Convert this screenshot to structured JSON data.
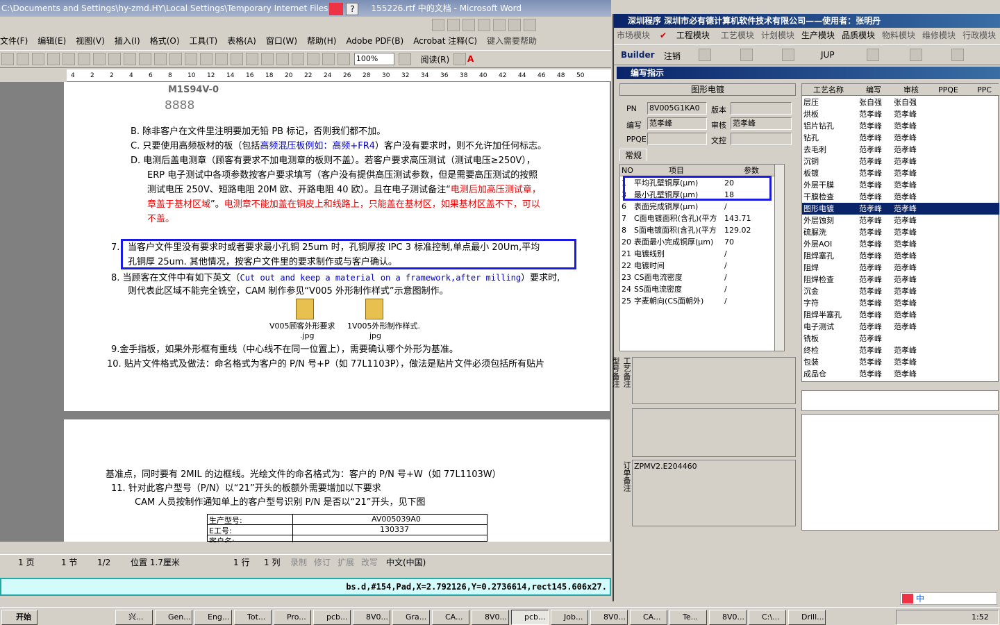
{
  "word": {
    "title": "C:\\Documents and Settings\\hy-zmd.HY\\Local Settings\\Temporary Internet Files",
    "title_suffix": "155226.rtf 中的文档 - Microsoft Word",
    "menu": [
      "文件(F)",
      "编辑(E)",
      "视图(V)",
      "插入(I)",
      "格式(O)",
      "工具(T)",
      "表格(A)",
      "窗口(W)",
      "帮助(H)",
      "Adobe PDF(B)",
      "Acrobat 注释(C)"
    ],
    "help_hint": "键入需要帮助",
    "zoom": "100%",
    "read_label": "阅读(R)",
    "ruler": [
      "4",
      "2",
      "2",
      "4",
      "6",
      "8",
      "10",
      "12",
      "14",
      "16",
      "18",
      "20",
      "22",
      "24",
      "26",
      "28",
      "30",
      "32",
      "34",
      "36",
      "38",
      "40",
      "42",
      "44",
      "46",
      "48",
      "50"
    ],
    "logo_text": "M1S94V-0",
    "logo_digits": "8888",
    "para_b": "B.  除非客户在文件里注明要加无铅 PB 标记，否则我们都不加。",
    "para_c_prefix": "C.  只要使用高频板材的板（包括",
    "para_c_blue": "高频混压板例如：高频+FR4",
    "para_c_suffix": "）客户没有要求时，则不允许加任何标志。",
    "para_d1": "D.  电测后盖电测章（顾客有要求不加电测章的板则不盖）。若客户要求高压测试（测试电压≥250V），",
    "para_d2": "ERP 电子测试中各项参数按客户要求填写（客户没有提供高压测试参数，但是需要高压测试的按照",
    "para_d3_a": "测试电压 250V、短路电阻 20M 欧、开路电阻 40 欧）。且在电子测试备注“",
    "para_d3_red": "电测后加高压测试章，",
    "para_d4_red1": "章盖于基材区域",
    "para_d4_mid": "”。",
    "para_d4_red2": "电测章不能加盖在铜皮上和线路上，只能盖在基材区，如果基材区盖不下，可以",
    "para_d5_red": "不盖。",
    "para_7_num": "7.",
    "para_7a": "当客户文件里没有要求时或者要求最小孔铜 25um 时，孔铜厚按 IPC 3 标准控制,单点最小 20Um,平均",
    "para_7b": "孔铜厚 25um. 其他情况，按客户文件里的要求制作或与客户确认。",
    "para_8a_pre": "8.  当顾客在文件中有如下英文（",
    "para_8a_blue": "Cut out and keep a material on a framework,after milling",
    "para_8a_post": "）要求时,",
    "para_8b": "则代表此区域不能完全铣空，CAM 制作参见“V005 外形制作样式”示意图制作。",
    "attach1": "V005顾客外形要求",
    "attach1b": ".jpg",
    "attach2": "1V005外形制作样式.",
    "attach2b": "jpg",
    "para_9": "9.金手指板，如果外形框有重线（中心线不在同一位置上），需要确认哪个外形为基准。",
    "para_10": "10. 贴片文件格式及做法：命名格式为客户的 P/N 号+P（如 77L1103P），做法是贴片文件必须包括所有贴片",
    "p2_line1": "基准点，同时要有 2MIL 的边框线。光绘文件的命名格式为：客户的  P/N 号+W（如 77L1103W）",
    "p2_line2": "11.  针对此客户型号（P/N）以“21”开头的板额外需要增加以下要求",
    "p2_line3": "CAM 人员按制作通知单上的客户型号识别 P/N 是否以“21”开头，见下图",
    "p2_table": [
      [
        "生产型号:",
        "AV005039A0"
      ],
      [
        "E工号:",
        "130337"
      ],
      [
        "客户名:",
        ""
      ]
    ],
    "status": {
      "page": "1 页",
      "section": "1 节",
      "pages": "1/2",
      "pos": "位置 1.7厘米",
      "line": "1 行",
      "col": "1 列",
      "rec": "录制",
      "rev": "修订",
      "ext": "扩展",
      "ovr": "改写",
      "lang": "中文(中国)"
    },
    "cmdline": "bs.d,#154,Pad,X=2.792126,Y=0.2736614,rect145.606x27."
  },
  "app": {
    "title": "深圳程序   深圳市必有德计算机软件技术有限公司——使用者：张明丹",
    "modules": [
      "市场模块",
      "工程模块",
      "工艺模块",
      "计划模块",
      "生产模块",
      "品质模块",
      "物料模块",
      "维修模块",
      "行政模块"
    ],
    "builder": "Builder",
    "logout": "注销",
    "jup": "JUP",
    "dialog_title": "编写指示",
    "process_name": "图形电镀",
    "fields": {
      "pn_label": "PN",
      "pn_value": "8V005G1KA0",
      "version_label": "版本",
      "version_value": "",
      "author_label": "编写",
      "author_value": "范孝峰",
      "audit_label": "审核",
      "audit_value": "范孝峰",
      "ppqe_label": "PPQE",
      "ppqe_value": "",
      "doc_label": "文控",
      "doc_value": ""
    },
    "tab": "常规",
    "param_headers": [
      "NO",
      "项目",
      "参数"
    ],
    "params": [
      [
        "1",
        "平均孔壁铜厚(μm)",
        "20"
      ],
      [
        "3",
        "最小孔壁铜厚(μm)",
        "18"
      ],
      [
        "6",
        "表面完成铜厚(μm)",
        "/"
      ],
      [
        "7",
        "C面电镀面积(含孔)(平方",
        "143.71"
      ],
      [
        "8",
        "S面电镀面积(含孔)(平方",
        "129.02"
      ],
      [
        "20",
        "表面最小完成铜厚(μm)",
        "70"
      ],
      [
        "21",
        "电镀线别",
        "/"
      ],
      [
        "22",
        "电镀时间",
        "/"
      ],
      [
        "23",
        "CS面电流密度",
        "/"
      ],
      [
        "24",
        "SS面电流密度",
        "/"
      ],
      [
        "25",
        "字麦朝向(CS面朝外)",
        "/"
      ]
    ],
    "remark_labels": [
      "工艺备注",
      "型号备注",
      "订单备注"
    ],
    "order_remark": "ZPMV2.E204460",
    "proc_headers": [
      "工艺名称",
      "编写",
      "审核",
      "PPQE",
      "PPC"
    ],
    "procs": [
      [
        "层压",
        "张自强",
        "张自强"
      ],
      [
        "烘板",
        "范孝峰",
        "范孝峰"
      ],
      [
        "铝片钻孔",
        "范孝峰",
        "范孝峰"
      ],
      [
        "钻孔",
        "范孝峰",
        "范孝峰"
      ],
      [
        "去毛刺",
        "范孝峰",
        "范孝峰"
      ],
      [
        "沉铜",
        "范孝峰",
        "范孝峰"
      ],
      [
        "板镀",
        "范孝峰",
        "范孝峰"
      ],
      [
        "外层干膜",
        "范孝峰",
        "范孝峰"
      ],
      [
        "干膜检查",
        "范孝峰",
        "范孝峰"
      ],
      [
        "图形电镀",
        "范孝峰",
        "范孝峰"
      ],
      [
        "外层蚀刻",
        "范孝峰",
        "范孝峰"
      ],
      [
        "硫脲洗",
        "范孝峰",
        "范孝峰"
      ],
      [
        "外层AOI",
        "范孝峰",
        "范孝峰"
      ],
      [
        "阻焊塞孔",
        "范孝峰",
        "范孝峰"
      ],
      [
        "阻焊",
        "范孝峰",
        "范孝峰"
      ],
      [
        "阻焊检查",
        "范孝峰",
        "范孝峰"
      ],
      [
        "沉金",
        "范孝峰",
        "范孝峰"
      ],
      [
        "字符",
        "范孝峰",
        "范孝峰"
      ],
      [
        "阻焊半塞孔",
        "范孝峰",
        "范孝峰"
      ],
      [
        "电子测试",
        "范孝峰",
        "范孝峰"
      ],
      [
        "铣板",
        "范孝峰",
        ""
      ],
      [
        "终检",
        "范孝峰",
        "范孝峰"
      ],
      [
        "包装",
        "范孝峰",
        "范孝峰"
      ],
      [
        "成品仓",
        "范孝峰",
        "范孝峰"
      ]
    ]
  },
  "taskbar": {
    "start": "开始",
    "tasks": [
      "兴...",
      "Gen...",
      "Eng...",
      "Tot...",
      "Pro...",
      "pcb...",
      "8V0...",
      "Gra...",
      "CA...",
      "8V0...",
      "pcb...",
      "Job...",
      "8V0...",
      "CA...",
      "Te...",
      "8V0...",
      "C:\\...",
      "Drill..."
    ],
    "clock": "1:52",
    "ime": "中"
  }
}
